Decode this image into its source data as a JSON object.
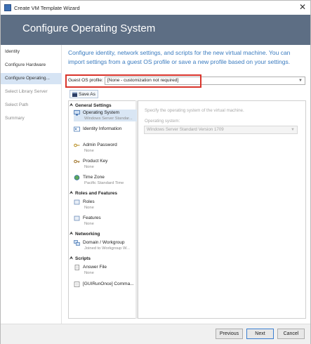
{
  "window": {
    "title": "Create VM Template Wizard",
    "close_glyph": "✕"
  },
  "header": {
    "page_title": "Configure Operating System"
  },
  "nav": [
    {
      "label": "Identity"
    },
    {
      "label": "Configure Hardware"
    },
    {
      "label": "Configure Operating..."
    },
    {
      "label": "Select Library Server"
    },
    {
      "label": "Select Path"
    },
    {
      "label": "Summary"
    }
  ],
  "intro": "Configure identity, network settings, and scripts for the new virtual machine. You can import settings from a guest OS profile or save a new profile based on your settings.",
  "guest_profile": {
    "label": "Guest OS profile:",
    "value": "[None - customization not required]"
  },
  "save_as": "Save As",
  "tree": {
    "general": {
      "label": "General Settings"
    },
    "operating_system": {
      "label": "Operating System",
      "sub": "Windows Server Standar..."
    },
    "identity_information": {
      "label": "Identity Information",
      "sub": ""
    },
    "admin_password": {
      "label": "Admin Password",
      "sub": "None"
    },
    "product_key": {
      "label": "Product Key",
      "sub": "None"
    },
    "time_zone": {
      "label": "Time Zone",
      "sub": "Pacific Standard Time"
    },
    "roles_features": {
      "label": "Roles and Features"
    },
    "roles": {
      "label": "Roles",
      "sub": "None"
    },
    "features": {
      "label": "Features",
      "sub": "None"
    },
    "networking": {
      "label": "Networking"
    },
    "domain_workgroup": {
      "label": "Domain / Workgroup",
      "sub": "Joined to Workgroup W..."
    },
    "scripts": {
      "label": "Scripts"
    },
    "answer_file": {
      "label": "Answer File",
      "sub": "None"
    },
    "gui_run_once": {
      "label": "[GUIRunOnce] Comma...",
      "sub": ""
    }
  },
  "detail": {
    "description": "Specify the operating system of the virtual machine.",
    "os_label": "Operating system:",
    "os_value": "Windows Server Standard Version 1709"
  },
  "buttons": {
    "previous": "Previous",
    "next": "Next",
    "cancel": "Cancel"
  }
}
